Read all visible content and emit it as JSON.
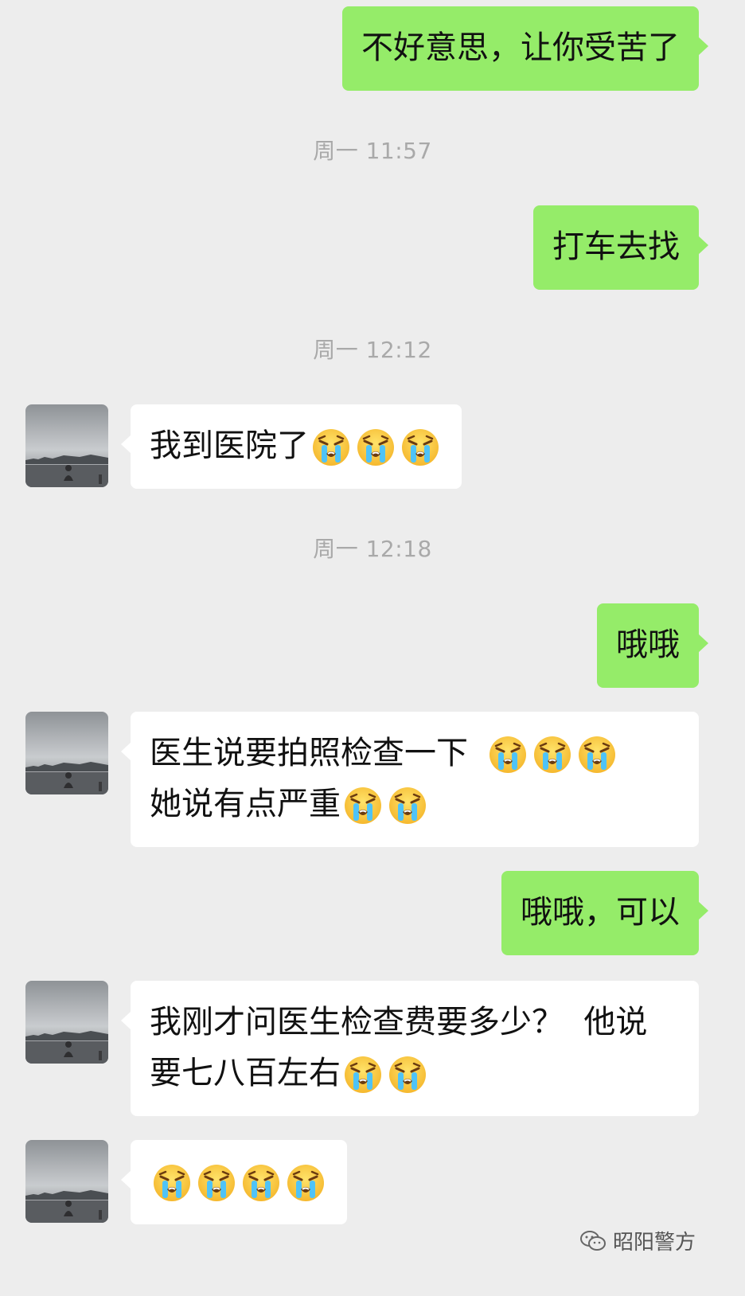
{
  "messages": [
    {
      "side": "me",
      "text": "不好意思，让你受苦了"
    },
    {
      "time": "周一 11:57"
    },
    {
      "side": "me",
      "text": "打车去找"
    },
    {
      "time": "周一 12:12"
    },
    {
      "side": "them",
      "text": "我到医院了",
      "emoji_count": 3
    },
    {
      "time": "周一 12:18"
    },
    {
      "side": "me",
      "text": "哦哦"
    },
    {
      "side": "them",
      "line1": "医生说要拍照检查一下",
      "line1_emoji": 3,
      "line2": "她说有点严重",
      "line2_emoji": 2
    },
    {
      "side": "me",
      "text": "哦哦，可以"
    },
    {
      "side": "them",
      "line1": "我刚才问医生检查费要多少？  他说",
      "line2": "要七八百左右",
      "line2_emoji": 2
    },
    {
      "side": "them",
      "emoji_count": 4
    }
  ],
  "emoji_icon": "loudly-crying-face",
  "watermark": {
    "icon": "wechat-icon",
    "text": "昭阳警方"
  },
  "colors": {
    "background": "#ededed",
    "my_bubble": "#95ec69",
    "their_bubble": "#ffffff",
    "timestamp": "#a9a9a9"
  }
}
